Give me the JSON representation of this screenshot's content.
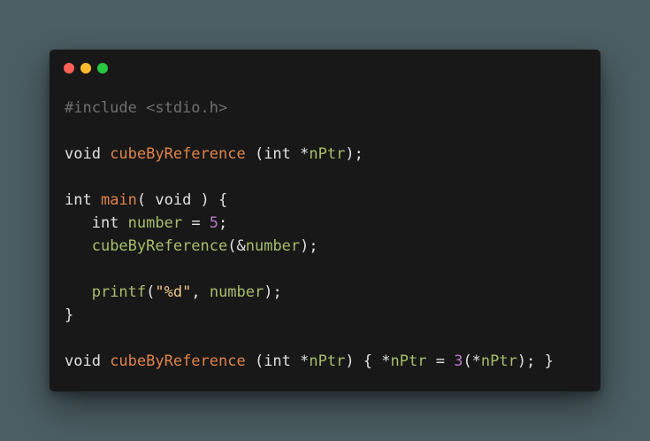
{
  "window": {
    "controls": {
      "close_color": "#ff5f56",
      "minimize_color": "#ffbd2e",
      "maximize_color": "#27c93f"
    }
  },
  "code": {
    "language": "c",
    "lines": [
      [
        {
          "t": "#include <stdio.h>",
          "k": "comment"
        }
      ],
      [],
      [
        {
          "t": "void ",
          "k": "plain"
        },
        {
          "t": "cubeByReference",
          "k": "fn"
        },
        {
          "t": " (int *",
          "k": "plain"
        },
        {
          "t": "nPtr",
          "k": "ident"
        },
        {
          "t": ");",
          "k": "plain"
        }
      ],
      [],
      [
        {
          "t": "int ",
          "k": "plain"
        },
        {
          "t": "main",
          "k": "fn"
        },
        {
          "t": "( void ) {",
          "k": "plain"
        }
      ],
      [
        {
          "t": "   int ",
          "k": "plain"
        },
        {
          "t": "number",
          "k": "ident"
        },
        {
          "t": " = ",
          "k": "plain"
        },
        {
          "t": "5",
          "k": "number"
        },
        {
          "t": ";",
          "k": "plain"
        }
      ],
      [
        {
          "t": "   ",
          "k": "plain"
        },
        {
          "t": "cubeByReference",
          "k": "ident"
        },
        {
          "t": "(&",
          "k": "plain"
        },
        {
          "t": "number",
          "k": "ident"
        },
        {
          "t": ");",
          "k": "plain"
        }
      ],
      [],
      [
        {
          "t": "   ",
          "k": "plain"
        },
        {
          "t": "printf",
          "k": "ident"
        },
        {
          "t": "(",
          "k": "plain"
        },
        {
          "t": "\"%d\"",
          "k": "string"
        },
        {
          "t": ", ",
          "k": "plain"
        },
        {
          "t": "number",
          "k": "ident"
        },
        {
          "t": ");",
          "k": "plain"
        }
      ],
      [
        {
          "t": "}",
          "k": "plain"
        }
      ],
      [],
      [
        {
          "t": "void ",
          "k": "plain"
        },
        {
          "t": "cubeByReference",
          "k": "fn"
        },
        {
          "t": " (int *",
          "k": "plain"
        },
        {
          "t": "nPtr",
          "k": "ident"
        },
        {
          "t": ") { *",
          "k": "plain"
        },
        {
          "t": "nPtr",
          "k": "ident"
        },
        {
          "t": " = ",
          "k": "plain"
        },
        {
          "t": "3",
          "k": "number"
        },
        {
          "t": "(*",
          "k": "plain"
        },
        {
          "t": "nPtr",
          "k": "ident"
        },
        {
          "t": "); }",
          "k": "plain"
        }
      ]
    ]
  }
}
